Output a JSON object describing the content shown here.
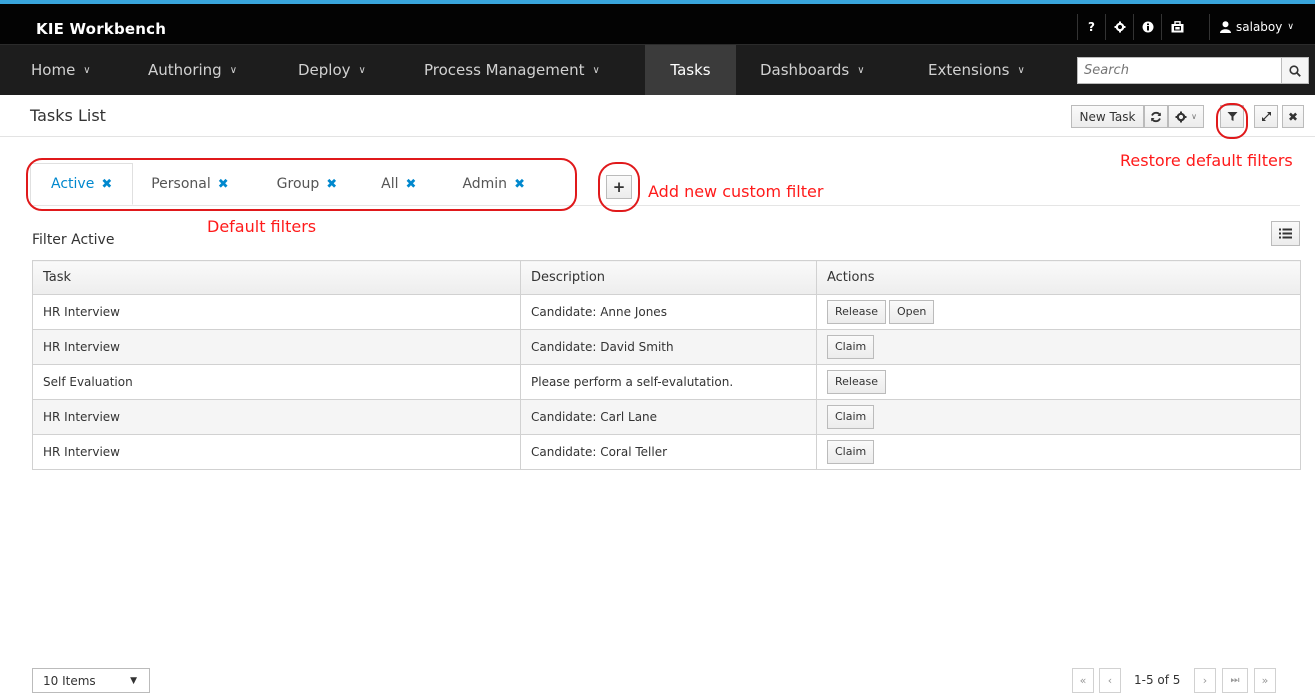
{
  "app": {
    "brand": "KIE Workbench",
    "user": "salaboy",
    "utility_icons": [
      "help-icon",
      "gear-icon",
      "info-icon",
      "briefcase-icon"
    ],
    "accent_color": "#39a5dc"
  },
  "nav": {
    "items": [
      {
        "label": "Home",
        "dropdown": true
      },
      {
        "label": "Authoring",
        "dropdown": true
      },
      {
        "label": "Deploy",
        "dropdown": true
      },
      {
        "label": "Process Management",
        "dropdown": true
      },
      {
        "label": "Tasks",
        "dropdown": false,
        "active": true
      },
      {
        "label": "Dashboards",
        "dropdown": true
      },
      {
        "label": "Extensions",
        "dropdown": true
      }
    ],
    "search_placeholder": "Search"
  },
  "header": {
    "title": "Tasks List",
    "new_task_label": "New Task"
  },
  "filters": {
    "tabs": [
      {
        "label": "Active",
        "active": true
      },
      {
        "label": "Personal",
        "active": false
      },
      {
        "label": "Group",
        "active": false
      },
      {
        "label": "All",
        "active": false
      },
      {
        "label": "Admin",
        "active": false
      }
    ],
    "add_label": "+",
    "current_label": "Filter Active"
  },
  "annotations": {
    "default_filters": "Default filters",
    "add_custom": "Add new custom filter",
    "restore_defaults": "Restore default filters",
    "color": "#e0191b"
  },
  "table": {
    "columns": [
      "Task",
      "Description",
      "Actions"
    ],
    "rows": [
      {
        "task": "HR Interview",
        "description": "Candidate: Anne Jones",
        "actions": [
          "Release",
          "Open"
        ]
      },
      {
        "task": "HR Interview",
        "description": "Candidate: David Smith",
        "actions": [
          "Claim"
        ]
      },
      {
        "task": "Self Evaluation",
        "description": "Please perform a self-evalutation.",
        "actions": [
          "Release"
        ]
      },
      {
        "task": "HR Interview",
        "description": "Candidate: Carl Lane",
        "actions": [
          "Claim"
        ]
      },
      {
        "task": "HR Interview",
        "description": "Candidate: Coral Teller",
        "actions": [
          "Claim"
        ]
      }
    ]
  },
  "pagination": {
    "page_size": "10 Items",
    "info": "1-5 of 5"
  }
}
